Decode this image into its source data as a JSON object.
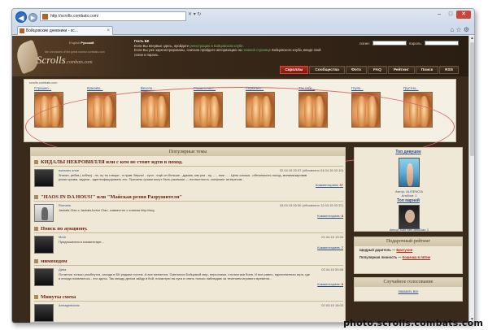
{
  "browser": {
    "url": "http://scrolls.combats.com/",
    "tab_label": "Бойцовские дневники - sc...",
    "tab_close": "×",
    "back": "◀",
    "forward": "▶",
    "addr_tools": "✕ ▾ ↻",
    "icons": "⌂ ☆ ⚙",
    "win_min": "–",
    "win_max": "□",
    "win_close": "✕"
  },
  "header": {
    "logo_name": "Scrolls",
    "logo_sub": ".combats.com",
    "lang_en": "English",
    "lang_ru": "Русский",
    "tagline": "the chronicles of the great warrior combats.com",
    "guest_title": "Гость БК",
    "guest_line1_pre": "Если Вы впервые здесь, пройдите ",
    "guest_line1_link": "регистрацию в Бойцовском клубе.",
    "guest_line2_pre": "Если Вы уже зарегистрированы, сначала пройдите авторизацию на ",
    "guest_line2_link": "главной странице",
    "guest_line2_post": " Бойцовского клуба, введя свой логин и пароль.",
    "login_label": "логин:",
    "password_label": "пароль:",
    "nav": [
      "Скроллы",
      "Сообщества",
      "Фото",
      "FAQ",
      "Рейтинг",
      "Поиск",
      "RSS"
    ]
  },
  "gallery": {
    "title": "scrolls.combats.com",
    "items": [
      "Страшно...",
      "Красиво...",
      "Весело...",
      "Романтично...",
      "Серьёзно...",
      "Так себе...",
      "Глупо...",
      "Грустно..."
    ]
  },
  "main": {
    "section_title": "Популярные темы",
    "topics": [
      {
        "title": "КИДАЛЫ НЕКРОВИЛЛЯ или с кем не стоит идти в поход.",
        "author": "поехало злое",
        "date": "02.04.15 20:37",
        "updated": "(обновлено 04.04.15 02:10)",
        "excerpt1": "Значит, ребзя ( гоблы) - пс, ну ты говори - я прав. Верно! - тупо - ещё он больше - думаю, как раз - ну, ... - нож ... - Цель списка - обезопасить поход, минимизировав",
        "excerpt2": "риски срыва, задача - идентифицировать это. Причины срыва могут быть разными — неопытность, конфликт интересов...",
        "comments_label": "Комментариев: ",
        "comments": "37",
        "avatar": "dark"
      },
      {
        "title": "\"HAOS IN DA HOUS!\" или \"Майская резня Разрушителя\"",
        "author": "Romario",
        "date": "03.03.15 00:30",
        "updated": "(обновлено 12.03.15 02:37)",
        "excerpt1": "Jackals Clan c  JackalsJunior Clan, совместно с кланом http://img",
        "excerpt2": "",
        "comments_label": "Комментариев: ",
        "comments": "8",
        "avatar": "light"
      },
      {
        "title": "Поиск по аукциону.",
        "author": "More",
        "date": "01.04.15 13:34",
        "updated": "",
        "excerpt1": "Предложения в комментари...",
        "excerpt2": "",
        "comments_label": "Комментариев: ",
        "comments": "7",
        "avatar": "dark"
      },
      {
        "title": "мимоходом",
        "author": "Дина",
        "date": "02.04.15 00:48",
        "updated": "",
        "excerpt1": "Остается только улыбнутся, заходя в БК редким гостем. А все меняется. Сменился Бойцовый мир, персонажи, стилистики боев. И все равно, единственная игра, где",
        "excerpt2": "я иногда появлялось - это здесь. Так между делом зайду в бой, посмотрю на луга и опять только наблюдаю за течением игрового времени...",
        "comments_label": "Комментариев: ",
        "comments": "8",
        "avatar": "dark"
      },
      {
        "title": "Минуты смеха",
        "author": "Armageddonic",
        "date": "02.03.15 16:03",
        "updated": "",
        "excerpt1": "",
        "excerpt2": "",
        "comments_label": "",
        "comments": "",
        "avatar": "dark"
      }
    ]
  },
  "sidebar": {
    "top_girl": "Топ девушек",
    "girl_author_label": "Автор: ",
    "girl_author": "ALISENCIA",
    "girl_album_label": "Альбом: ",
    "girl_album": "1",
    "top_guy": "Топ парней",
    "guy_author_label": "Автор: ",
    "guy_author": "Бал Бес",
    "guy_album_label": "Альбом: ",
    "guy_album": "1",
    "rating_title": "Подарочный рейтинг",
    "generous_label": "Щедрый даритель — ",
    "generous": "Братухин",
    "popular_label": "Популярная личность — ",
    "popular": "Кошечка в пятне",
    "poll_title": "Случайное голосование",
    "poll_action": "показать все"
  },
  "watermark": "photo.scrolls.combats.com"
}
